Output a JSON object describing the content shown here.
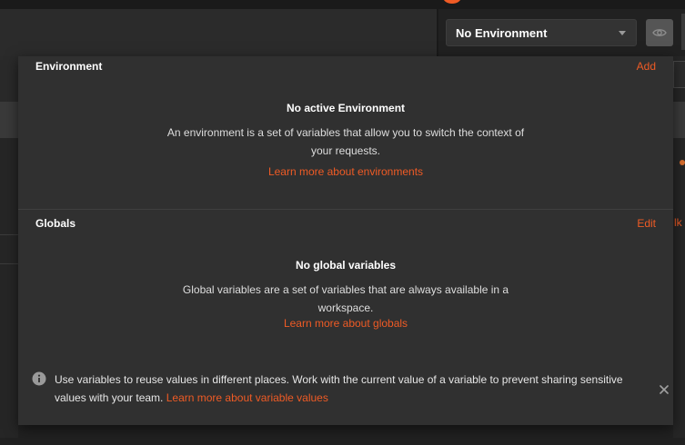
{
  "env_selector": {
    "selected": "No Environment"
  },
  "environment": {
    "title": "Environment",
    "action": "Add",
    "empty_heading": "No active Environment",
    "empty_desc": "An environment is a set of variables that allow you to switch the context of your requests.",
    "link": "Learn more about environments"
  },
  "globals": {
    "title": "Globals",
    "action": "Edit",
    "empty_heading": "No global variables",
    "empty_desc": "Global variables are a set of variables that are always available in a workspace.",
    "link": "Learn more about globals"
  },
  "info": {
    "text": "Use variables to reuse values in different places. Work with the current value of a variable to prevent sharing sensitive values with your team.",
    "link": "Learn more about variable values"
  },
  "background": {
    "truncated_right_text": "lk"
  },
  "colors": {
    "accent": "#ef5b25",
    "panel": "#303030",
    "page": "#212121"
  },
  "icons": [
    "caret-down-icon",
    "eye-icon",
    "info-icon",
    "close-icon"
  ]
}
